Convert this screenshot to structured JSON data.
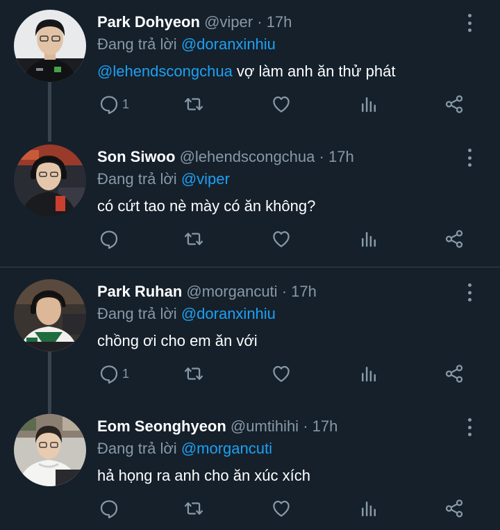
{
  "reply_prefix": "Đang trả lời",
  "dot": "·",
  "colors": {
    "background": "#15202b",
    "text_secondary": "#8899a6",
    "accent": "#1da1f2",
    "divider": "#38444d"
  },
  "icons": [
    "reply-icon",
    "retweet-icon",
    "like-icon",
    "analytics-icon",
    "share-icon",
    "more-icon"
  ],
  "tweets": [
    {
      "name": "Park Dohyeon",
      "handle": "@viper",
      "time": "17h",
      "reply_to": "@doranxinhiu",
      "text_mention": "@lehendscongchua",
      "text": " vợ làm anh ăn thử phát",
      "reply_count": "1"
    },
    {
      "name": "Son Siwoo",
      "handle": "@lehendscongchua",
      "time": "17h",
      "reply_to": "@viper",
      "text_mention": "",
      "text": "có cứt tao nè mày có ăn không?",
      "reply_count": ""
    },
    {
      "name": "Park Ruhan",
      "handle": "@morgancuti",
      "time": "17h",
      "reply_to": "@doranxinhiu",
      "text_mention": "",
      "text": "chồng ơi cho em ăn với",
      "reply_count": "1"
    },
    {
      "name": "Eom Seonghyeon",
      "handle": "@umtihihi",
      "time": "17h",
      "reply_to": "@morgancuti",
      "text_mention": "",
      "text": "hả họng ra anh cho ăn xúc xích",
      "reply_count": ""
    }
  ]
}
